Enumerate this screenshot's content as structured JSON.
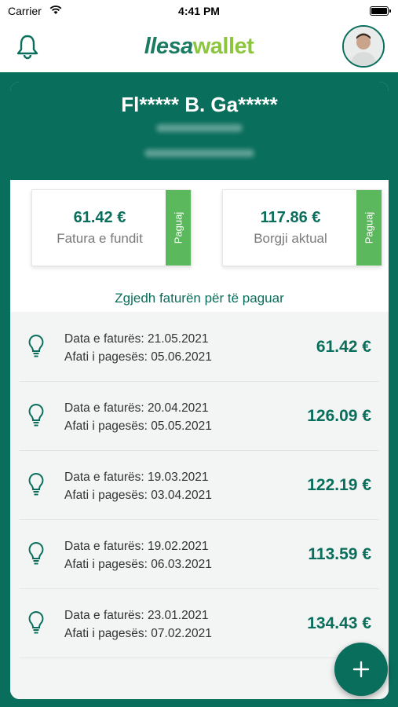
{
  "status_bar": {
    "carrier": "Carrier",
    "time": "4:41 PM"
  },
  "header": {
    "logo_part1": "ll",
    "logo_part2": "esa",
    "logo_part3": "wallet"
  },
  "user": {
    "name": "Fl***** B. Ga*****"
  },
  "summary": {
    "last_invoice": {
      "amount": "61.42 €",
      "label": "Fatura e fundit",
      "pay_label": "Paguaj"
    },
    "current_debt": {
      "amount": "117.86 €",
      "label": "Borgji aktual",
      "pay_label": "Paguaj"
    }
  },
  "list_title": "Zgjedh faturën për të paguar",
  "invoices": [
    {
      "date": "Data e faturës: 21.05.2021",
      "due": "Afati i pagesës: 05.06.2021",
      "amount": "61.42 €"
    },
    {
      "date": "Data e faturës: 20.04.2021",
      "due": "Afati i pagesës: 05.05.2021",
      "amount": "126.09 €"
    },
    {
      "date": "Data e faturës: 19.03.2021",
      "due": "Afati i pagesës: 03.04.2021",
      "amount": "122.19 €"
    },
    {
      "date": "Data e faturës: 19.02.2021",
      "due": "Afati i pagesës: 06.03.2021",
      "amount": "113.59 €"
    },
    {
      "date": "Data e faturës: 23.01.2021",
      "due": "Afati i pagesës: 07.02.2021",
      "amount": "134.43 €"
    }
  ],
  "icons": {
    "bell": "bell-icon",
    "bulb": "lightbulb-icon",
    "add": "plus-icon",
    "wifi": "wifi-icon",
    "battery": "battery-icon"
  },
  "colors": {
    "primary": "#0a6e5c",
    "accent": "#8cc63f",
    "pay": "#5cb85c"
  }
}
